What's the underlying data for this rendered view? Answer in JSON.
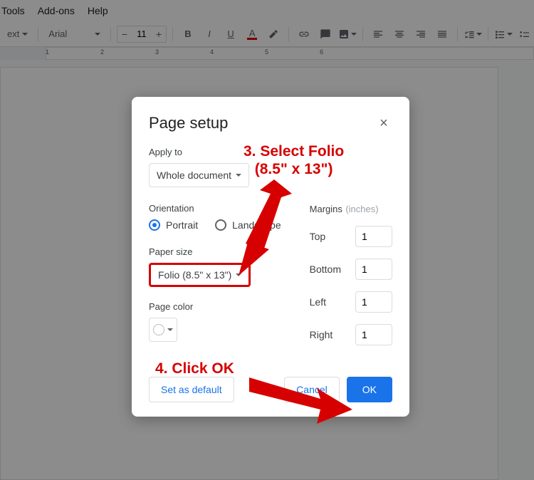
{
  "menus": [
    "Tools",
    "Add-ons",
    "Help"
  ],
  "toolbar": {
    "style_dd": "ext",
    "font_dd": "Arial",
    "font_size": "11"
  },
  "ruler_marks": [
    "1",
    "2",
    "3",
    "4",
    "5",
    "6"
  ],
  "dialog": {
    "title": "Page setup",
    "apply_to_label": "Apply to",
    "apply_to_value": "Whole document",
    "orientation_label": "Orientation",
    "portrait": "Portrait",
    "landscape": "Landscape",
    "paper_size_label": "Paper size",
    "paper_size_value": "Folio (8.5\" x 13\")",
    "page_color_label": "Page color",
    "margins_label": "Margins",
    "margins_hint": "(inches)",
    "top_label": "Top",
    "top_val": "1",
    "bottom_label": "Bottom",
    "bottom_val": "1",
    "left_label": "Left",
    "left_val": "1",
    "right_label": "Right",
    "right_val": "1",
    "set_default": "Set as default",
    "cancel": "Cancel",
    "ok": "OK"
  },
  "annotations": {
    "step3_l1": "3. Select Folio",
    "step3_l2": "(8.5\" x 13\")",
    "step4": "4. Click OK"
  }
}
